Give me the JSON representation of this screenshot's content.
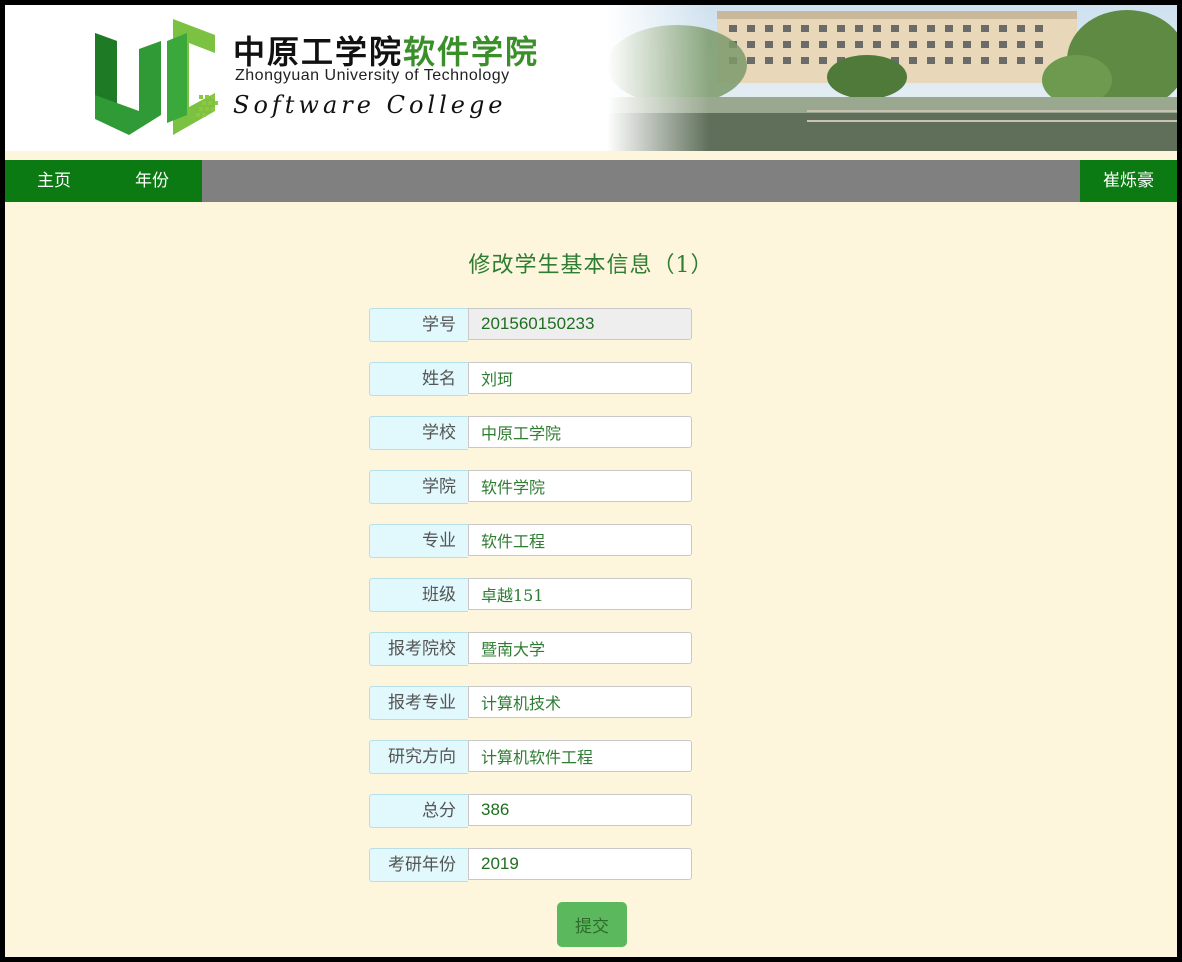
{
  "banner": {
    "title_cn_black": "中原工学院",
    "title_cn_green": "软件学院",
    "title_en": "Zhongyuan University of Technology",
    "subtitle": "Software College",
    "logo_icon": "uc-logo-icon",
    "campus_image": "campus-building-photo"
  },
  "nav": {
    "items": [
      {
        "label": "主页"
      },
      {
        "label": "年份"
      }
    ],
    "user": "崔烁豪"
  },
  "form": {
    "title": "修改学生基本信息（1）",
    "fields": [
      {
        "label": "学号",
        "value": "201560150233"
      },
      {
        "label": "姓名",
        "value": "刘珂"
      },
      {
        "label": "学校",
        "value": "中原工学院"
      },
      {
        "label": "学院",
        "value": "软件学院"
      },
      {
        "label": "专业",
        "value": "软件工程"
      },
      {
        "label": "班级",
        "value": "卓越151"
      },
      {
        "label": "报考院校",
        "value": "暨南大学"
      },
      {
        "label": "报考专业",
        "value": "计算机技术"
      },
      {
        "label": "研究方向",
        "value": "计算机软件工程"
      },
      {
        "label": "总分",
        "value": "386"
      },
      {
        "label": "考研年份",
        "value": "2019"
      }
    ],
    "submit_label": "提交"
  },
  "colors": {
    "nav_green": "#0b7a12",
    "nav_gray": "#808080",
    "page_bg": "#fdf6dc",
    "title_green": "#2e7d32",
    "label_bg": "#e1f8fc",
    "button_green": "#5cb85c"
  }
}
